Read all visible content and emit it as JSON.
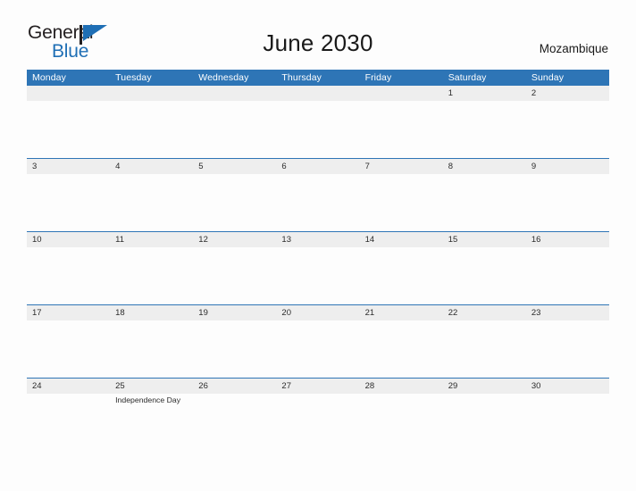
{
  "logo": {
    "word_one": "General",
    "word_two": "Blue",
    "flag_icon": "flag-triangle-icon",
    "color_black": "#231f20",
    "color_blue": "#1f6fb5"
  },
  "header": {
    "title": "June 2030",
    "country": "Mozambique"
  },
  "theme": {
    "header_blue": "#2e75b6",
    "date_band_gray": "#eeeeee",
    "page_background": "#fdfdfd",
    "text_dark": "#2b2b2b"
  },
  "calendar": {
    "weekdays": [
      "Monday",
      "Tuesday",
      "Wednesday",
      "Thursday",
      "Friday",
      "Saturday",
      "Sunday"
    ],
    "weeks": [
      {
        "days": [
          {
            "date": "",
            "events": []
          },
          {
            "date": "",
            "events": []
          },
          {
            "date": "",
            "events": []
          },
          {
            "date": "",
            "events": []
          },
          {
            "date": "",
            "events": []
          },
          {
            "date": "1",
            "events": []
          },
          {
            "date": "2",
            "events": []
          }
        ]
      },
      {
        "days": [
          {
            "date": "3",
            "events": []
          },
          {
            "date": "4",
            "events": []
          },
          {
            "date": "5",
            "events": []
          },
          {
            "date": "6",
            "events": []
          },
          {
            "date": "7",
            "events": []
          },
          {
            "date": "8",
            "events": []
          },
          {
            "date": "9",
            "events": []
          }
        ]
      },
      {
        "days": [
          {
            "date": "10",
            "events": []
          },
          {
            "date": "11",
            "events": []
          },
          {
            "date": "12",
            "events": []
          },
          {
            "date": "13",
            "events": []
          },
          {
            "date": "14",
            "events": []
          },
          {
            "date": "15",
            "events": []
          },
          {
            "date": "16",
            "events": []
          }
        ]
      },
      {
        "days": [
          {
            "date": "17",
            "events": []
          },
          {
            "date": "18",
            "events": []
          },
          {
            "date": "19",
            "events": []
          },
          {
            "date": "20",
            "events": []
          },
          {
            "date": "21",
            "events": []
          },
          {
            "date": "22",
            "events": []
          },
          {
            "date": "23",
            "events": []
          }
        ]
      },
      {
        "days": [
          {
            "date": "24",
            "events": []
          },
          {
            "date": "25",
            "events": [
              "Independence Day"
            ]
          },
          {
            "date": "26",
            "events": []
          },
          {
            "date": "27",
            "events": []
          },
          {
            "date": "28",
            "events": []
          },
          {
            "date": "29",
            "events": []
          },
          {
            "date": "30",
            "events": []
          }
        ]
      }
    ]
  }
}
